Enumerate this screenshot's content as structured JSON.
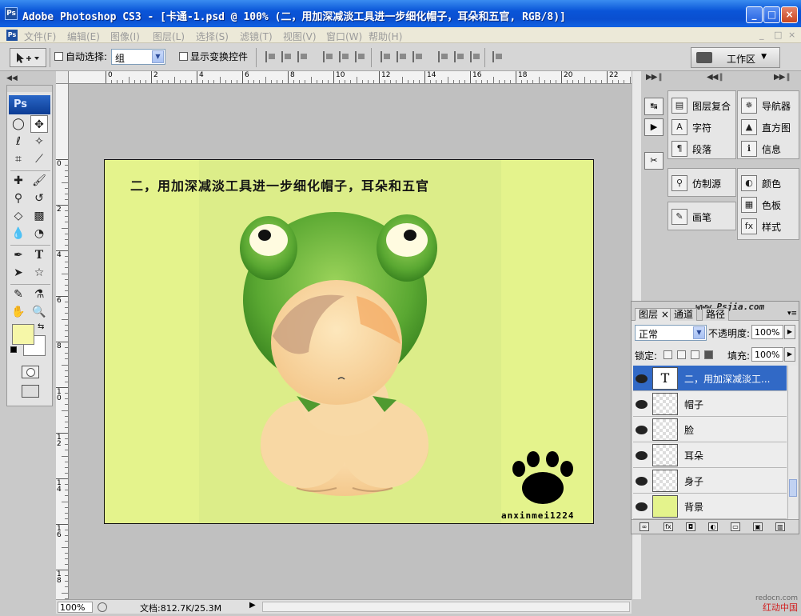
{
  "window": {
    "title": "Adobe Photoshop CS3 - [卡通-1.psd @ 100% (二，用加深减淡工具进一步细化帽子，耳朵和五官, RGB/8)]",
    "minimize": "_",
    "maximize": "□",
    "close": "×"
  },
  "menubar": {
    "items": [
      "文件(F)",
      "编辑(E)",
      "图像(I)",
      "图层(L)",
      "选择(S)",
      "滤镜(T)",
      "视图(V)",
      "窗口(W)",
      "帮助(H)"
    ],
    "doc_controls": [
      "_",
      "□",
      "×"
    ]
  },
  "options": {
    "auto_select_label": "自动选择:",
    "auto_select_value": "组",
    "show_transform_label": "显示变换控件",
    "workspace_label": "工作区"
  },
  "rulers": {
    "top_labels": [
      "0",
      "2",
      "4",
      "6",
      "8",
      "10",
      "12",
      "14",
      "16",
      "18",
      "20",
      "22"
    ],
    "left_labels": [
      "0",
      "2",
      "4",
      "6",
      "8",
      "1 0",
      "1 2",
      "1 4",
      "1 6",
      "1 8"
    ]
  },
  "toolbox": {
    "badge": "Ps"
  },
  "canvas": {
    "title": "二，用加深减淡工具进一步细化帽子，耳朵和五官",
    "watermark": "anxinmei1224",
    "background_color": "#e4f38c"
  },
  "statusbar": {
    "zoom": "100%",
    "doc_info": "文档:812.7K/25.3M"
  },
  "panels": {
    "col1": [
      "图层复合",
      "字符",
      "段落",
      "仿制源",
      "画笔"
    ],
    "col2": [
      "导航器",
      "直方图",
      "信息",
      "颜色",
      "色板",
      "样式"
    ]
  },
  "layers_panel": {
    "tabs": [
      "图层",
      "通道",
      "路径"
    ],
    "site": "www.Psjia.com",
    "blend_mode": "正常",
    "opacity_label": "不透明度:",
    "opacity_value": "100%",
    "lock_label": "锁定:",
    "fill_label": "填充:",
    "fill_value": "100%",
    "layers": [
      {
        "name": "二，用加深减淡工...",
        "type": "text",
        "selected": true
      },
      {
        "name": "帽子",
        "type": "image",
        "selected": false
      },
      {
        "name": "脸",
        "type": "image",
        "selected": false
      },
      {
        "name": "耳朵",
        "type": "image",
        "selected": false
      },
      {
        "name": "身子",
        "type": "image",
        "selected": false
      },
      {
        "name": "背景",
        "type": "fill",
        "selected": false
      }
    ],
    "text_thumb": "T"
  },
  "corner_watermark": {
    "url": "redocn.com",
    "text": "红动中国"
  }
}
